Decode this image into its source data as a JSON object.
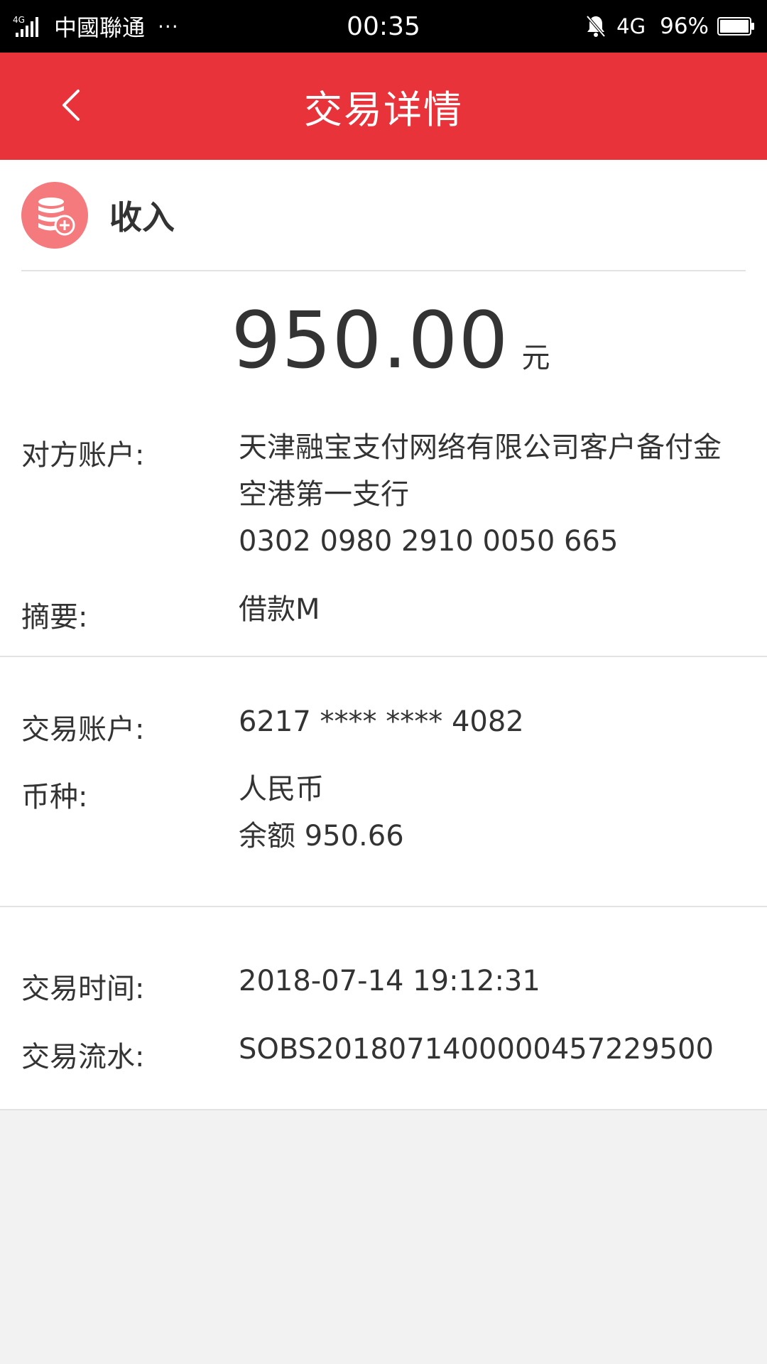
{
  "status_bar": {
    "network_small": "4G",
    "carrier": "中國聯通",
    "more": "···",
    "time": "00:35",
    "network_type": "4G",
    "battery": "96%"
  },
  "header": {
    "title": "交易详情",
    "background_color": "#e8333b"
  },
  "transaction": {
    "type": "收入",
    "amount": "950.00",
    "unit": "元",
    "counterparty_label": "对方账户:",
    "counterparty_name": "天津融宝支付网络有限公司客户备付金",
    "counterparty_bank": "空港第一支行",
    "counterparty_account": "0302 0980 2910 0050 665",
    "summary_label": "摘要:",
    "summary": "借款M",
    "account_label": "交易账户:",
    "account": "6217 **** **** 4082",
    "currency_label": "币种:",
    "currency": "人民币",
    "balance": "余额 950.66",
    "time_label": "交易时间:",
    "time": "2018-07-14 19:12:31",
    "serial_label": "交易流水:",
    "serial": "SOBS2018071400000457229500"
  }
}
